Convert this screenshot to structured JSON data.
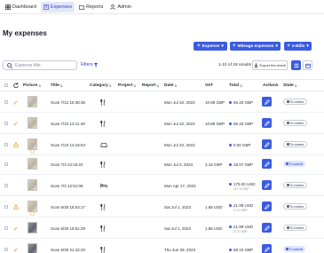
{
  "nav": {
    "tabs": [
      {
        "label": "Dashboard",
        "icon": "dashboard-icon"
      },
      {
        "label": "Expenses",
        "icon": "receipt-icon",
        "active": true
      },
      {
        "label": "Reports",
        "icon": "folder-icon"
      },
      {
        "label": "Admin",
        "icon": "person-icon"
      }
    ]
  },
  "page": {
    "title": "My expenses"
  },
  "actions": {
    "expense": "Expense",
    "mileage": "Mileage expenses",
    "ebills": "e-Bills"
  },
  "toolbar": {
    "search_placeholder": "Expense title",
    "filters_label": "Filters",
    "results": "1-10 of 18 results",
    "export_label": "Export the result"
  },
  "columns": [
    "Picture",
    "Title",
    "Category",
    "Project",
    "Report",
    "Date",
    "VAT",
    "Total",
    "Actions",
    "State"
  ],
  "rows": [
    {
      "title": "Scan 7/12 16:38:36",
      "category": "fork-knife-icon",
      "date": "Mon Jul 10, 2023",
      "vat": "10.89 GBP",
      "total": "65.40 GBP",
      "sub": "",
      "state": "To review",
      "flag": "link",
      "thumb": "light"
    },
    {
      "title": "Scan 7/10 13:11:49",
      "category": "fork-knife-icon",
      "date": "Mon Jul 10, 2023",
      "vat": "10.89 GBP",
      "total": "65.40 GBP",
      "sub": "",
      "state": "To review",
      "flag": "link",
      "thumb": "light"
    },
    {
      "title": "Scan 7/10 13:16:54",
      "category": "car-icon",
      "date": "Mon Jul 10, 2023",
      "vat": "",
      "total": "0.00 GBP",
      "sub": "",
      "state": "To review",
      "flag": "warning",
      "thumb": "light"
    },
    {
      "title": "Scan 7/3 22:16:22",
      "category": "fork-knife-icon",
      "date": "Mon Jul 3, 2023",
      "vat": "3.18 GBP",
      "total": "19.07 GBP",
      "sub": "",
      "state": "To submit",
      "flag": "",
      "thumb": "light"
    },
    {
      "title": "Scan 7/3 12:51:08",
      "category": "hotel-icon",
      "date": "Mon Apr 17, 2023",
      "vat": "",
      "total": "175.00 USD",
      "sub": "147.13 GBP",
      "state": "To review",
      "flag": "",
      "thumb": "light"
    },
    {
      "title": "Scan 6/30 16:53:17",
      "category": "fork-knife-icon",
      "date": "Sat Jul 1, 2023",
      "vat": "1.88 USD",
      "total": "21.99 USD",
      "sub": "17.31 GBP",
      "state": "To review",
      "flag": "warning",
      "thumb": "light"
    },
    {
      "title": "Scan 6/30 18:51:29",
      "category": "fork-knife-icon",
      "date": "Sat Jul 1, 2023",
      "vat": "1.88 USD",
      "total": "21.99 USD",
      "sub": "17.31 GBP",
      "state": "To review",
      "flag": "link",
      "thumb": "dark"
    },
    {
      "title": "Scan 6/30 21:42:20",
      "category": "fork-knife-icon",
      "date": "Thu Jun 29, 2023",
      "vat": "",
      "total": "88.10 GBP",
      "sub": "",
      "state": "To submit",
      "flag": "link",
      "thumb": "dark"
    }
  ],
  "colors": {
    "accent": "#3b5be0",
    "warning": "#e8a33b"
  }
}
